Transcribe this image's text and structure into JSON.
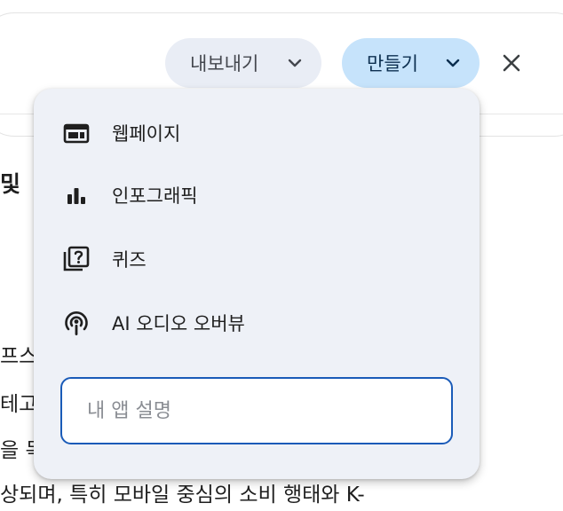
{
  "header": {
    "export_label": "내보내기",
    "create_label": "만들기"
  },
  "background_text": {
    "heading_fragment": "및",
    "line1": "프스",
    "line2": "테고",
    "line3": "을 목",
    "line4": "상되며, 특히 모바일 중심의 소비 행태와 K-"
  },
  "menu": {
    "items": [
      {
        "label": "웹페이지",
        "icon": "webpage-icon"
      },
      {
        "label": "인포그래픽",
        "icon": "bar-chart-icon"
      },
      {
        "label": "퀴즈",
        "icon": "quiz-icon"
      },
      {
        "label": "AI 오디오 오버뷰",
        "icon": "podcast-icon"
      }
    ],
    "input_placeholder": "내 앱 설명"
  },
  "colors": {
    "create_chip": "#c6e3fb",
    "export_chip": "#e9edf5",
    "menu_bg": "#eef1f7",
    "input_border": "#1a5bb8"
  }
}
